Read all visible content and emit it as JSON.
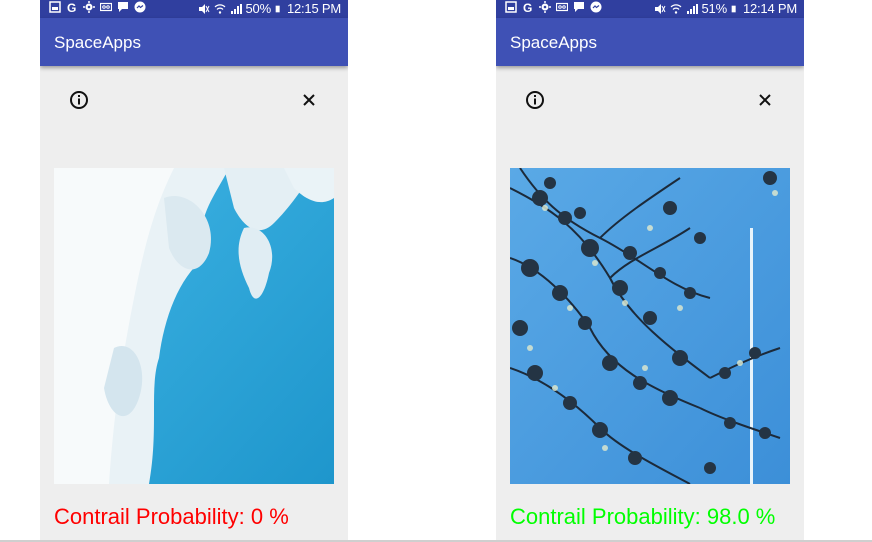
{
  "screens": [
    {
      "status": {
        "battery": "50%",
        "time": "12:15 PM"
      },
      "app_title": "SpaceApps",
      "toolbar": {
        "info_icon": "info-icon",
        "close_icon": "close-icon"
      },
      "photo": {
        "description_icon": "cloud-sky-photo"
      },
      "result": {
        "label": "Contrail Probability: 0 %",
        "color": "#ff0000"
      }
    },
    {
      "status": {
        "battery": "51%",
        "time": "12:14 PM"
      },
      "app_title": "SpaceApps",
      "toolbar": {
        "info_icon": "info-icon",
        "close_icon": "close-icon"
      },
      "photo": {
        "description_icon": "tree-branches-contrail-photo"
      },
      "result": {
        "label": "Contrail Probability: 98.0 %",
        "color": "#00ff00"
      }
    }
  ],
  "colors": {
    "status_bar": "#303f9f",
    "app_bar": "#3f51b5",
    "background": "#eeeeee"
  }
}
